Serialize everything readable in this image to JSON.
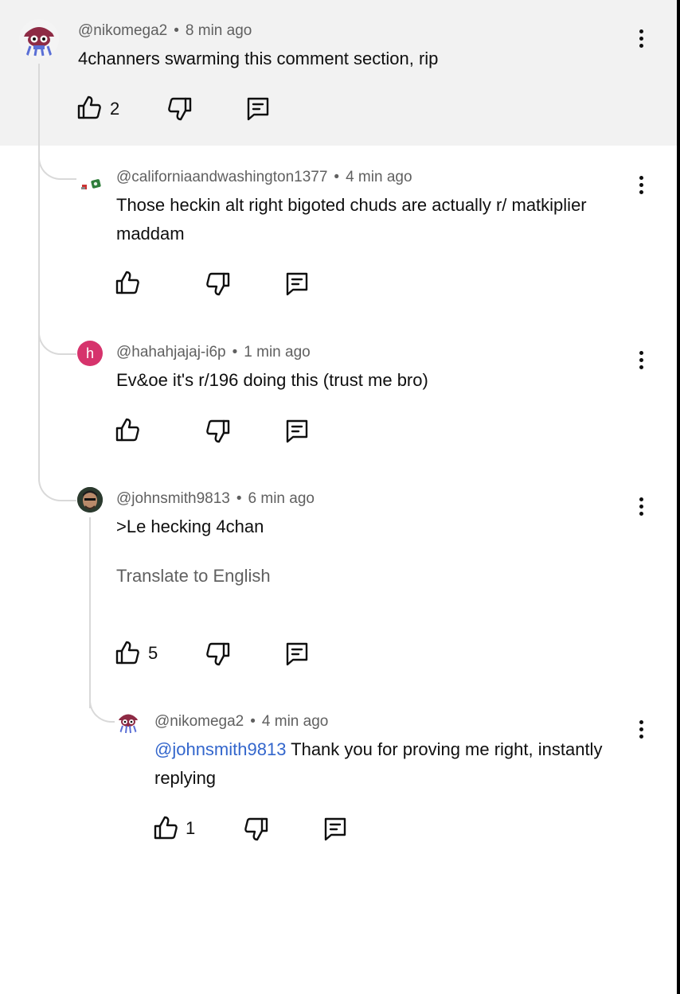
{
  "comments": [
    {
      "handle": "@nikomega2",
      "time": "8 min ago",
      "text": "4channers swarming this comment section, rip",
      "likes": "2"
    },
    {
      "handle": "@californiaandwashington1377",
      "time": "4 min ago",
      "text": "Those heckin alt right bigoted chuds are actually r/ matkiplier maddam",
      "likes": ""
    },
    {
      "handle": "@hahahjajaj-i6p",
      "time": "1 min ago",
      "text": "Ev&oe it's r/196 doing this (trust me bro)",
      "likes": "",
      "avatar_letter": "h"
    },
    {
      "handle": "@johnsmith9813",
      "time": "6 min ago",
      "text": ">Le hecking 4chan",
      "translate": "Translate to English",
      "likes": "5"
    },
    {
      "handle": "@nikomega2",
      "time": "4 min ago",
      "mention": "@johnsmith9813",
      "text": " Thank you for proving me right, instantly replying",
      "likes": "1"
    }
  ],
  "meta_separator": "•",
  "colors": {
    "highlight": "#f2f2f2",
    "meta": "#606060",
    "link": "#3366cc",
    "thread_line": "#d9d9d9",
    "letter_avatar": "#d6336c"
  },
  "icons": {
    "like": "thumbs-up-icon",
    "dislike": "thumbs-down-icon",
    "reply": "reply-icon",
    "menu": "more-vertical-icon"
  }
}
